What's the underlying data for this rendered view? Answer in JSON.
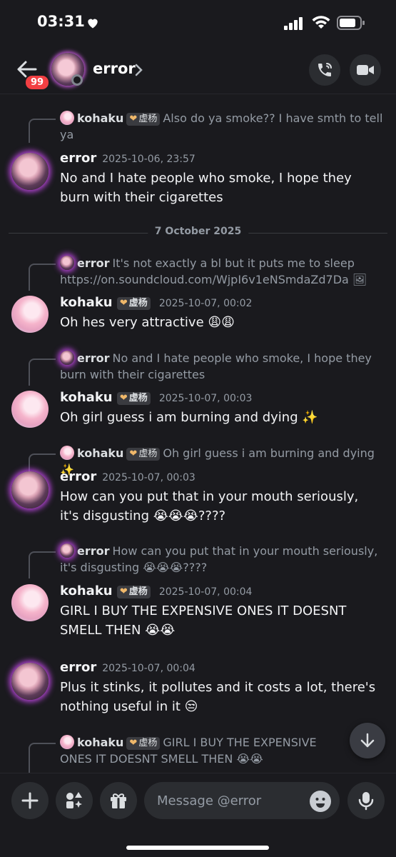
{
  "status_bar": {
    "time": "03:31"
  },
  "header": {
    "unread_badge": "99",
    "title": "error"
  },
  "chat": {
    "date_divider": "7 October 2025",
    "messages": [
      {
        "reply": {
          "name": "kohaku",
          "tag": "虚杨",
          "text": "Also do ya smoke?? I have smth to tell ya"
        },
        "author": "error",
        "timestamp": "2025-10-06, 23:57",
        "text": "No and I hate people who smoke, I hope they burn with their cigarettes"
      },
      {
        "reply": {
          "name": "error",
          "text": "It's not exactly a bl but it puts me to sleep https://on.soundcloud.com/WjpI6v1eNSmdaZd7Da 🖼"
        },
        "author": "kohaku",
        "tag": "虚杨",
        "timestamp": "2025-10-07, 00:02",
        "text": "Oh hes very attractive 😩😩"
      },
      {
        "reply": {
          "name": "error",
          "text": "No and I hate people who smoke, I hope they burn with their cigarettes"
        },
        "author": "kohaku",
        "tag": "虚杨",
        "timestamp": "2025-10-07, 00:03",
        "text": "Oh girl guess i am burning and dying ✨"
      },
      {
        "reply": {
          "name": "kohaku",
          "tag": "虚杨",
          "text": "Oh girl guess i am burning and dying ✨"
        },
        "author": "error",
        "timestamp": "2025-10-07, 00:03",
        "text": "How can you put that in your mouth seriously, it's disgusting  😭😭😭????"
      },
      {
        "reply": {
          "name": "error",
          "text": "How can you put that in your mouth seriously, it's disgusting  😭😭😭????"
        },
        "author": "kohaku",
        "tag": "虚杨",
        "timestamp": "2025-10-07, 00:04",
        "text": "GIRL I BUY THE EXPENSIVE ONES IT DOESNT SMELL THEN 😭😭"
      },
      {
        "author": "error",
        "timestamp": "2025-10-07, 00:04",
        "text": "Plus it stinks, it pollutes and it costs a lot, there's nothing useful in it 😒"
      },
      {
        "reply": {
          "name": "kohaku",
          "tag": "虚杨",
          "text": "GIRL I BUY THE EXPENSIVE ONES IT DOESNT SMELL THEN 😭😭"
        }
      }
    ]
  },
  "composer": {
    "placeholder": "Message @error"
  }
}
